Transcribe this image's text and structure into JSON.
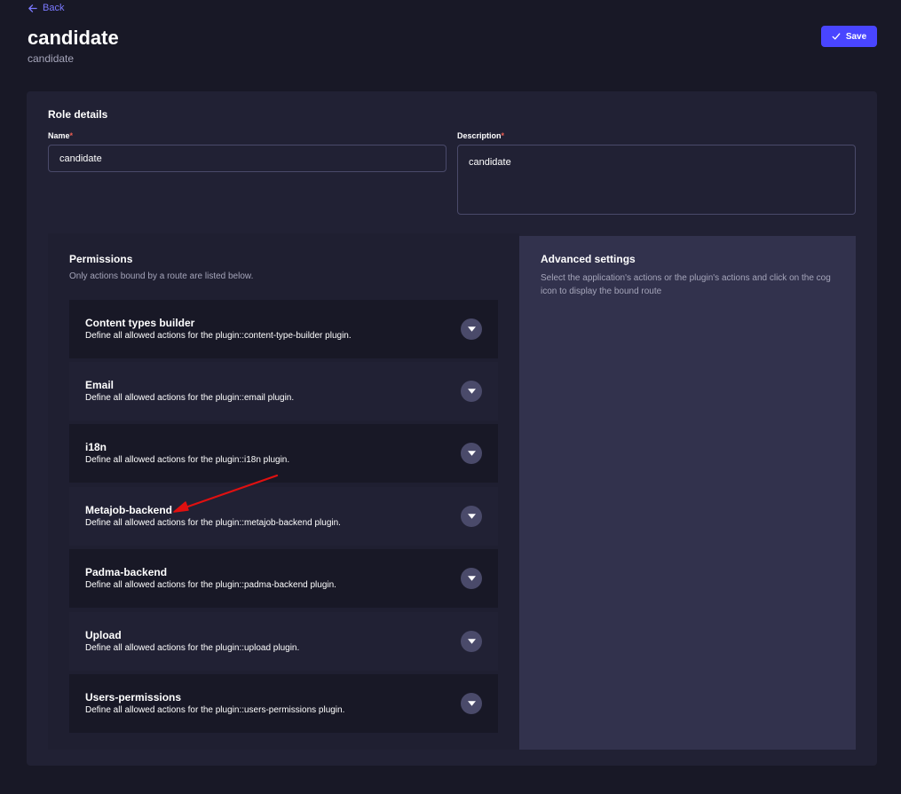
{
  "header": {
    "back_label": "Back",
    "title": "candidate",
    "subtitle": "candidate",
    "save_label": "Save"
  },
  "role_details": {
    "section_title": "Role details",
    "name_label": "Name",
    "name_value": "candidate",
    "description_label": "Description",
    "description_value": "candidate",
    "required_mark": "*"
  },
  "permissions": {
    "title": "Permissions",
    "subtitle": "Only actions bound by a route are listed below.",
    "items": [
      {
        "title": "Content types builder",
        "description": "Define all allowed actions for the plugin::content-type-builder plugin."
      },
      {
        "title": "Email",
        "description": "Define all allowed actions for the plugin::email plugin."
      },
      {
        "title": "i18n",
        "description": "Define all allowed actions for the plugin::i18n plugin."
      },
      {
        "title": "Metajob-backend",
        "description": "Define all allowed actions for the plugin::metajob-backend plugin."
      },
      {
        "title": "Padma-backend",
        "description": "Define all allowed actions for the plugin::padma-backend plugin."
      },
      {
        "title": "Upload",
        "description": "Define all allowed actions for the plugin::upload plugin."
      },
      {
        "title": "Users-permissions",
        "description": "Define all allowed actions for the plugin::users-permissions plugin."
      }
    ]
  },
  "advanced_settings": {
    "title": "Advanced settings",
    "description": "Select the application's actions or the plugin's actions and click on the cog icon to display the bound route"
  },
  "icons": {
    "back": "arrow-left-icon",
    "save": "check-icon",
    "toggle": "chevron-down-icon",
    "annotation": "red-arrow-annotation"
  },
  "colors": {
    "accent": "#4945ff",
    "back_link": "#7b79ff",
    "required": "#ee5e52",
    "annotation": "#e01010"
  }
}
